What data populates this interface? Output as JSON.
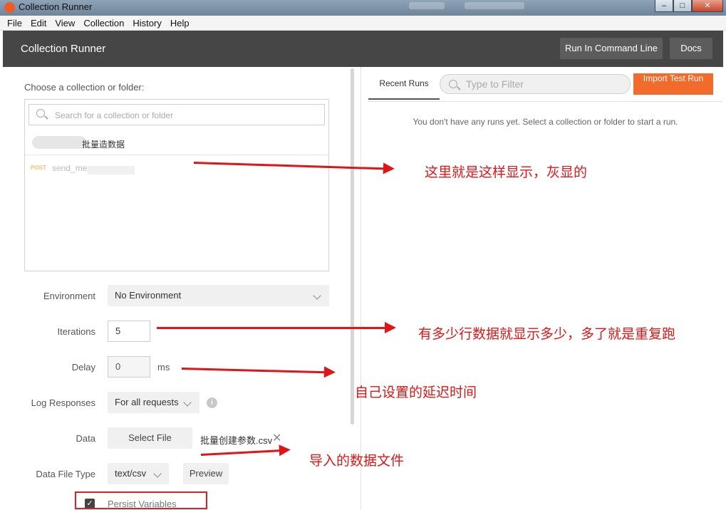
{
  "window": {
    "title": "Collection Runner"
  },
  "menu": [
    "File",
    "Edit",
    "View",
    "Collection",
    "History",
    "Help"
  ],
  "header": {
    "title": "Collection Runner",
    "run_cli_label": "Run In Command Line",
    "docs_label": "Docs"
  },
  "left": {
    "choose_label": "Choose a collection or folder:",
    "search_placeholder": "Search for a collection or folder",
    "folder_name": "批量造数据",
    "request_method": "POST",
    "request_name": "send_me",
    "environment_label": "Environment",
    "environment_value": "No Environment",
    "iterations_label": "Iterations",
    "iterations_value": "5",
    "delay_label": "Delay",
    "delay_value": "0",
    "delay_unit": "ms",
    "log_label": "Log Responses",
    "log_value": "For all requests",
    "data_label": "Data",
    "select_file_label": "Select File",
    "data_file_name": "批量创建参数.csv",
    "data_type_label": "Data File Type",
    "data_type_value": "text/csv",
    "preview_label": "Preview",
    "persist_label": "Persist Variables",
    "persist_checked": true
  },
  "right": {
    "tab_label": "Recent Runs",
    "filter_placeholder": "Type to Filter",
    "import_label": "Import Test Run",
    "empty_message": "You don't have any runs yet. Select a collection or folder to start a run."
  },
  "annotations": {
    "note1": "这里就是这样显示，灰显的",
    "note2": "有多少行数据就显示多少，多了就是重复跑",
    "note3": "自己设置的延迟时间",
    "note4": "导入的数据文件",
    "color": "#e01515"
  },
  "colors": {
    "accent": "#f26b2a",
    "header": "#464646"
  }
}
